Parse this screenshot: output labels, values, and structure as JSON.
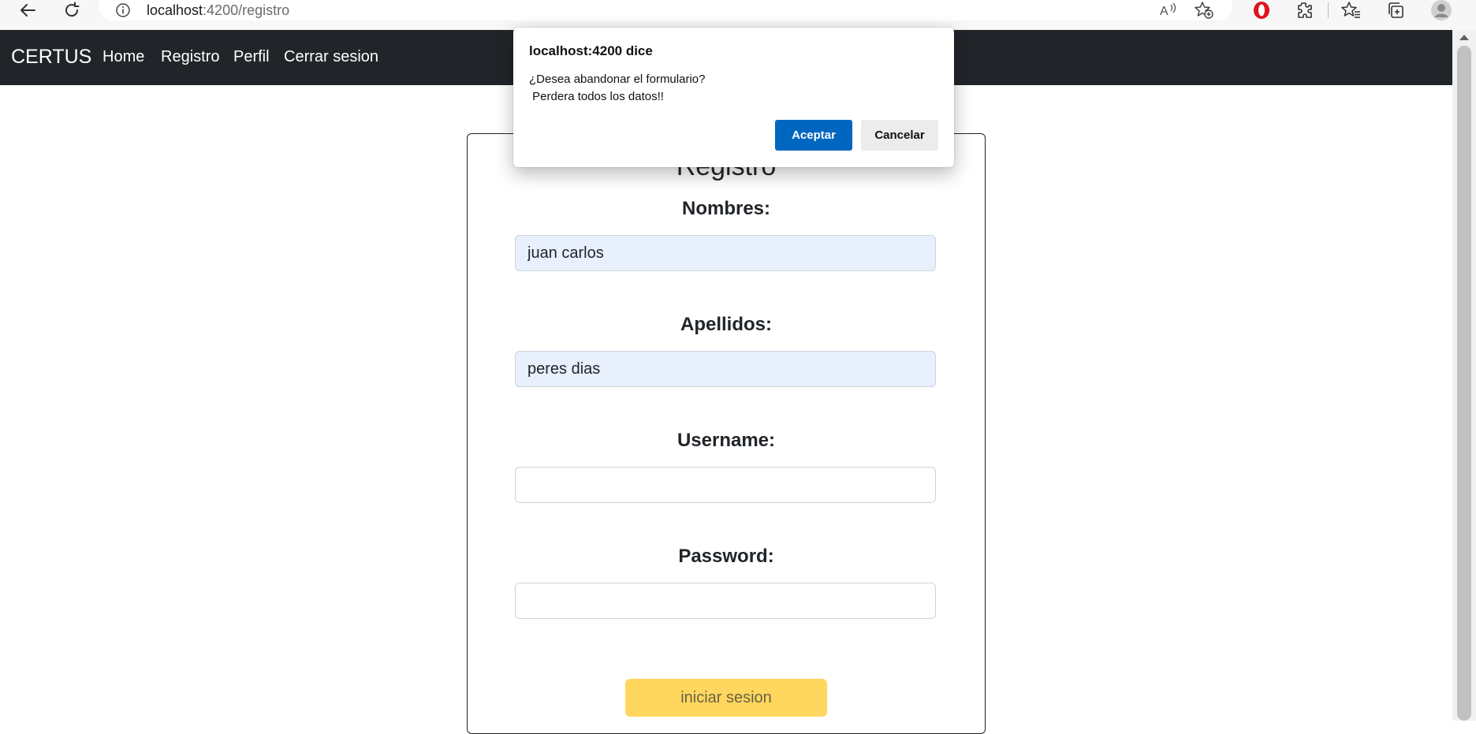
{
  "browser": {
    "url_host": "localhost",
    "url_path": ":4200/registro"
  },
  "navbar": {
    "brand": "CERTUS",
    "links": [
      "Home",
      "Registro",
      "Perfil",
      "Cerrar sesion"
    ],
    "background": "#212529"
  },
  "form": {
    "title": "Registro",
    "nombres_label": "Nombres:",
    "nombres_value": "juan carlos",
    "apellidos_label": "Apellidos:",
    "apellidos_value": "peres dias",
    "username_label": "Username:",
    "username_value": "",
    "password_label": "Password:",
    "password_value": "",
    "submit_label": "iniciar sesion",
    "submit_color": "#ffd65e"
  },
  "dialog": {
    "title": "localhost:4200 dice",
    "message": "¿Desea abandonar el formulario?\n Perdera todos los datos!!",
    "ok_label": "Aceptar",
    "cancel_label": "Cancelar",
    "ok_color": "#0067c0"
  },
  "icons": [
    "back-icon",
    "refresh-icon",
    "info-icon",
    "read-aloud-icon",
    "favorite-add-icon",
    "opera-icon",
    "extensions-icon",
    "favorites-icon",
    "collections-icon",
    "profile-icon"
  ]
}
